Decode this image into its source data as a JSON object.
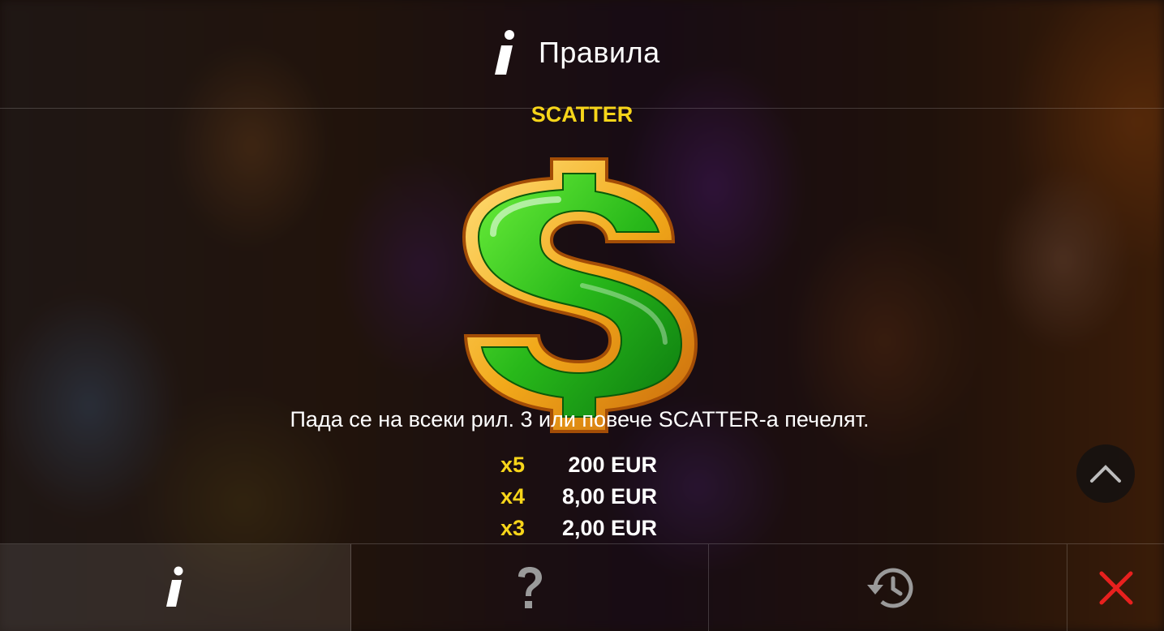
{
  "header": {
    "title": "Правила",
    "icon": "info-icon"
  },
  "symbol": {
    "name": "SCATTER",
    "image": "green-dollar-sign-symbol",
    "description": "Пада се на всеки рил. 3 или повече SCATTER-а печелят.",
    "payouts": [
      {
        "multiplier": "x5",
        "amount": "200 EUR"
      },
      {
        "multiplier": "x4",
        "amount": "8,00 EUR"
      },
      {
        "multiplier": "x3",
        "amount": "2,00 EUR"
      }
    ]
  },
  "scroll_up": {
    "icon": "chevron-up-icon"
  },
  "bottom_bar": {
    "tabs": [
      {
        "icon": "info-icon",
        "active": true
      },
      {
        "icon": "question-mark-icon",
        "active": false
      },
      {
        "icon": "history-icon",
        "active": false
      },
      {
        "icon": "close-icon",
        "active": false
      }
    ]
  },
  "colors": {
    "accent_yellow": "#f7d51a",
    "close_red": "#e8201e",
    "symbol_green": "#2fc21a",
    "symbol_gold": "#f2b21c"
  }
}
